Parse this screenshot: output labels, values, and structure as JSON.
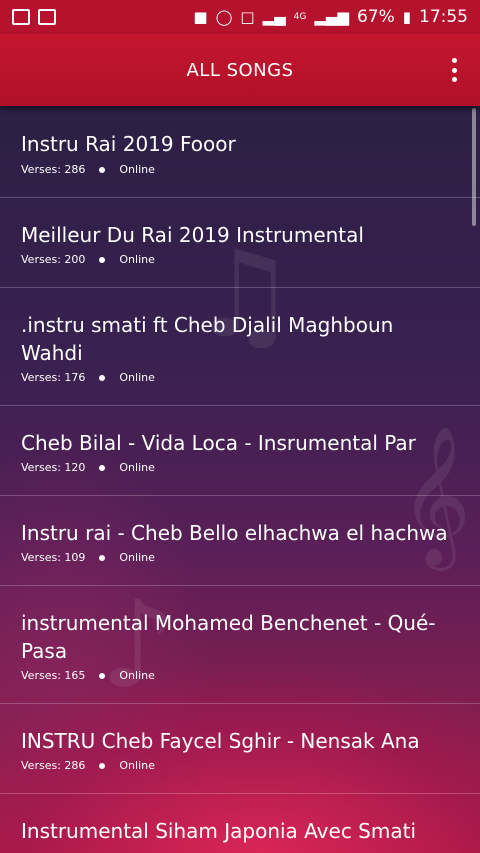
{
  "status_bar": {
    "battery": "67%",
    "time": "17:55",
    "network": "4G"
  },
  "header": {
    "title": "ALL SONGS"
  },
  "songs": [
    {
      "title": "Instru Rai 2019 Fooor",
      "verses": "Verses: 286",
      "status": "Online"
    },
    {
      "title": "Meilleur Du Rai 2019 Instrumental",
      "verses": "Verses: 200",
      "status": "Online"
    },
    {
      "title": ".instru smati ft Cheb Djalil Maghboun Wahdi",
      "verses": "Verses: 176",
      "status": "Online"
    },
    {
      "title": "Cheb Bilal - Vida Loca - Insrumental Par",
      "verses": "Verses: 120",
      "status": "Online"
    },
    {
      "title": "Instru rai - Cheb Bello elhachwa el hachwa",
      "verses": "Verses: 109",
      "status": "Online"
    },
    {
      "title": "instrumental Mohamed Benchenet - Qué-Pasa",
      "verses": "Verses: 165",
      "status": "Online"
    },
    {
      "title": "INSTRU Cheb Faycel Sghir - Nensak Ana",
      "verses": "Verses: 286",
      "status": "Online"
    },
    {
      "title": "Instrumental Siham Japonia Avec Smati",
      "verses": "",
      "status": ""
    }
  ]
}
